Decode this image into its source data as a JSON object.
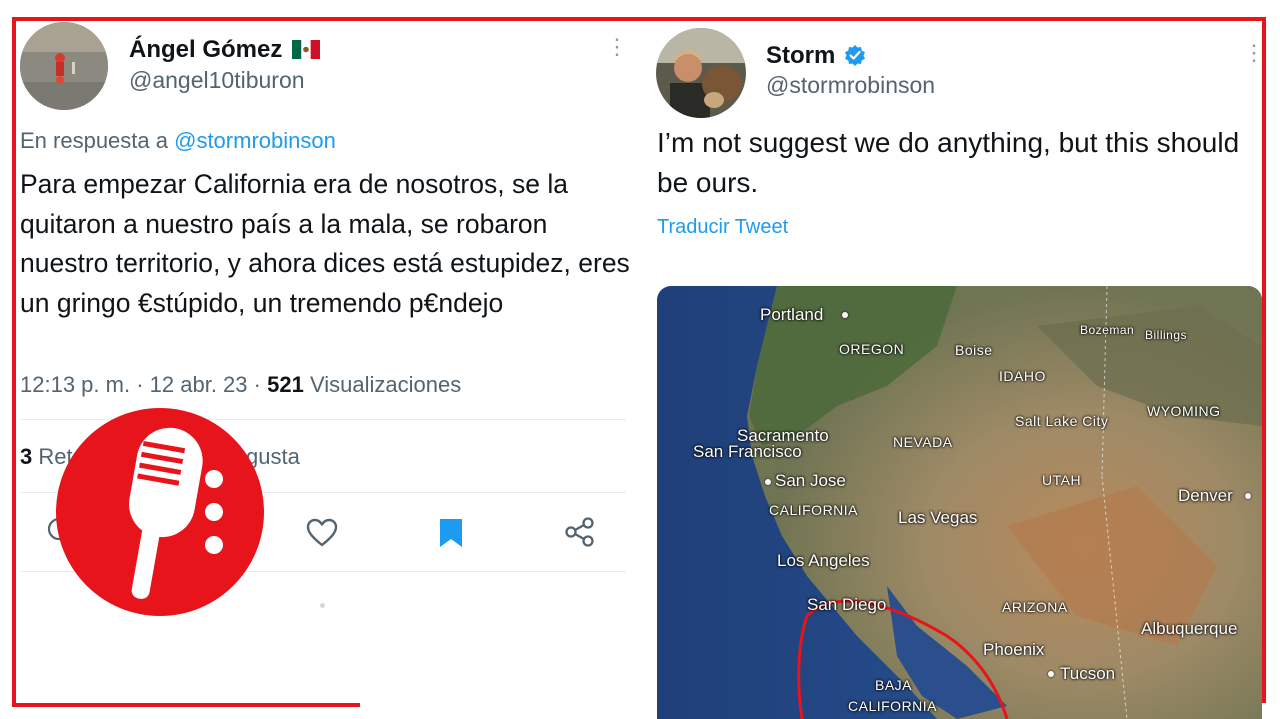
{
  "left_tweet": {
    "display_name": "Ángel Gómez",
    "flag": "🇲🇽",
    "handle": "@angel10tiburon",
    "reply_prefix": "En respuesta a",
    "reply_mention": "@stormrobinson",
    "text": "Para empezar California era de nosotros, se la quitaron a nuestro país a la mala, se robaron nuestro territorio, y ahora dices está estupidez, eres un gringo €stúpido, un tremendo p€ndejo",
    "time": "12:13 p. m.",
    "date": "12 abr. 23",
    "views_count": "521",
    "views_label": "Visualizaciones",
    "retweets_count": "3",
    "retweets_label_visible": "Ret",
    "likes_label_visible": "gusta",
    "more": "⋮"
  },
  "right_tweet": {
    "display_name": "Storm",
    "handle": "@stormrobinson",
    "text": "I’m not suggest we do anything, but this should be ours.",
    "translate": "Traducir Tweet",
    "more": "⋮"
  },
  "map": {
    "labels": {
      "portland": "Portland",
      "oregon": "OREGON",
      "boise": "Boise",
      "idaho": "IDAHO",
      "bozeman": "Bozeman",
      "billings": "Billings",
      "wyoming": "WYOMING",
      "salt_lake": "Salt Lake City",
      "sacramento": "Sacramento",
      "san_francisco": "San Francisco",
      "nevada": "NEVADA",
      "utah": "UTAH",
      "san_jose": "San Jose",
      "denver": "Denver",
      "california": "CALIFORNIA",
      "las_vegas": "Las Vegas",
      "los_angeles": "Los Angeles",
      "san_diego": "San Diego",
      "arizona": "ARIZONA",
      "albuquerque": "Albuquerque",
      "phoenix": "Phoenix",
      "tucson": "Tucson",
      "baja": "BAJA",
      "baja_california": "CALIFORNIA"
    }
  },
  "colors": {
    "frame": "#e8141b",
    "link": "#1d9bf0",
    "verified": "#1d9bf0",
    "bookmark": "#1d9bf0",
    "logo_red": "#e8141b"
  }
}
